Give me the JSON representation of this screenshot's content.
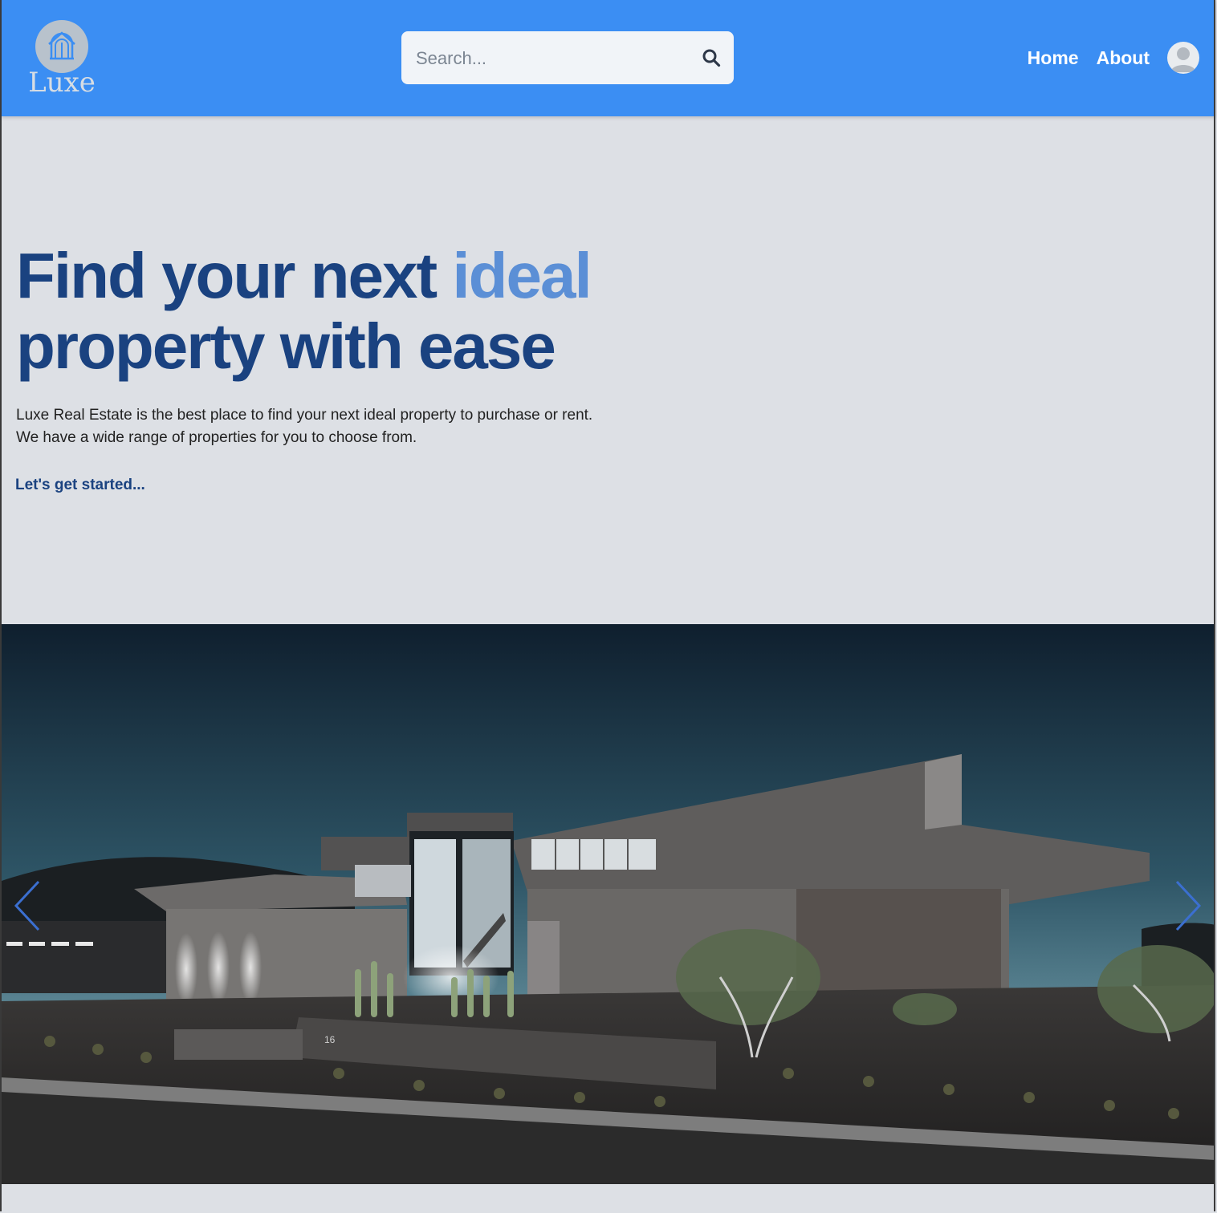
{
  "header": {
    "logo_text": "Luxe",
    "search_placeholder": "Search...",
    "nav": [
      {
        "label": "Home"
      },
      {
        "label": "About"
      }
    ],
    "colors": {
      "bar": "#3b8ef3"
    }
  },
  "hero": {
    "title_part1": "Find your next ",
    "title_accent": "ideal",
    "title_part2": "property with ease",
    "description_line1": "Luxe Real Estate is the best place to find your next ideal property to purchase or rent.",
    "description_line2": "We have a wide range of properties for you to choose from.",
    "cta_label": "Let's get started...",
    "colors": {
      "title": "#1a4280",
      "accent": "#5b8fd6"
    }
  },
  "carousel": {
    "slide_image": "modern-house-night-photo",
    "prev_icon": "chevron-left-icon",
    "next_icon": "chevron-right-icon",
    "house_number": "16"
  }
}
